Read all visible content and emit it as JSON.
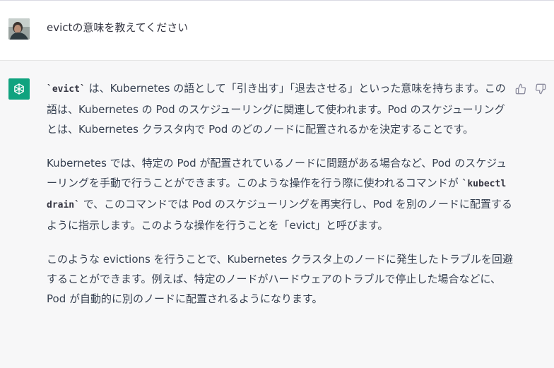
{
  "colors": {
    "assistant_bg": "#f7f7f8",
    "gpt_logo_bg": "#10a37f",
    "text": "#374151"
  },
  "user": {
    "avatar_icon": "user-avatar-photo",
    "message": "evictの意味を教えてください"
  },
  "assistant": {
    "logo_icon": "openai-logo-icon",
    "paragraphs": [
      {
        "code_1": "`evict`",
        "text_1": " は、Kubernetes の語として「引き出す」「退去させる」といった意味を持ちます。この語は、Kubernetes の Pod のスケジューリングに関連して使われます。Pod のスケジューリングとは、Kubernetes クラスタ内で Pod のどのノードに配置されるかを決定することです。"
      },
      {
        "text_1": "Kubernetes では、特定の Pod が配置されているノードに問題がある場合など、Pod のスケジューリングを手動で行うことができます。このような操作を行う際に使われるコマンドが ",
        "code_1": "`kubectl drain`",
        "text_2": " で、このコマンドでは Pod のスケジューリングを再実行し、Pod を別のノードに配置するように指示します。このような操作を行うことを「evict」と呼びます。"
      },
      {
        "text_1": "このような evictions を行うことで、Kubernetes クラスタ上のノードに発生したトラブルを回避することができます。例えば、特定のノードがハードウェアのトラブルで停止した場合などに、Pod が自動的に別のノードに配置されるようになります。"
      }
    ],
    "feedback": {
      "thumbs_up_icon": "thumbs-up-icon",
      "thumbs_down_icon": "thumbs-down-icon"
    }
  }
}
